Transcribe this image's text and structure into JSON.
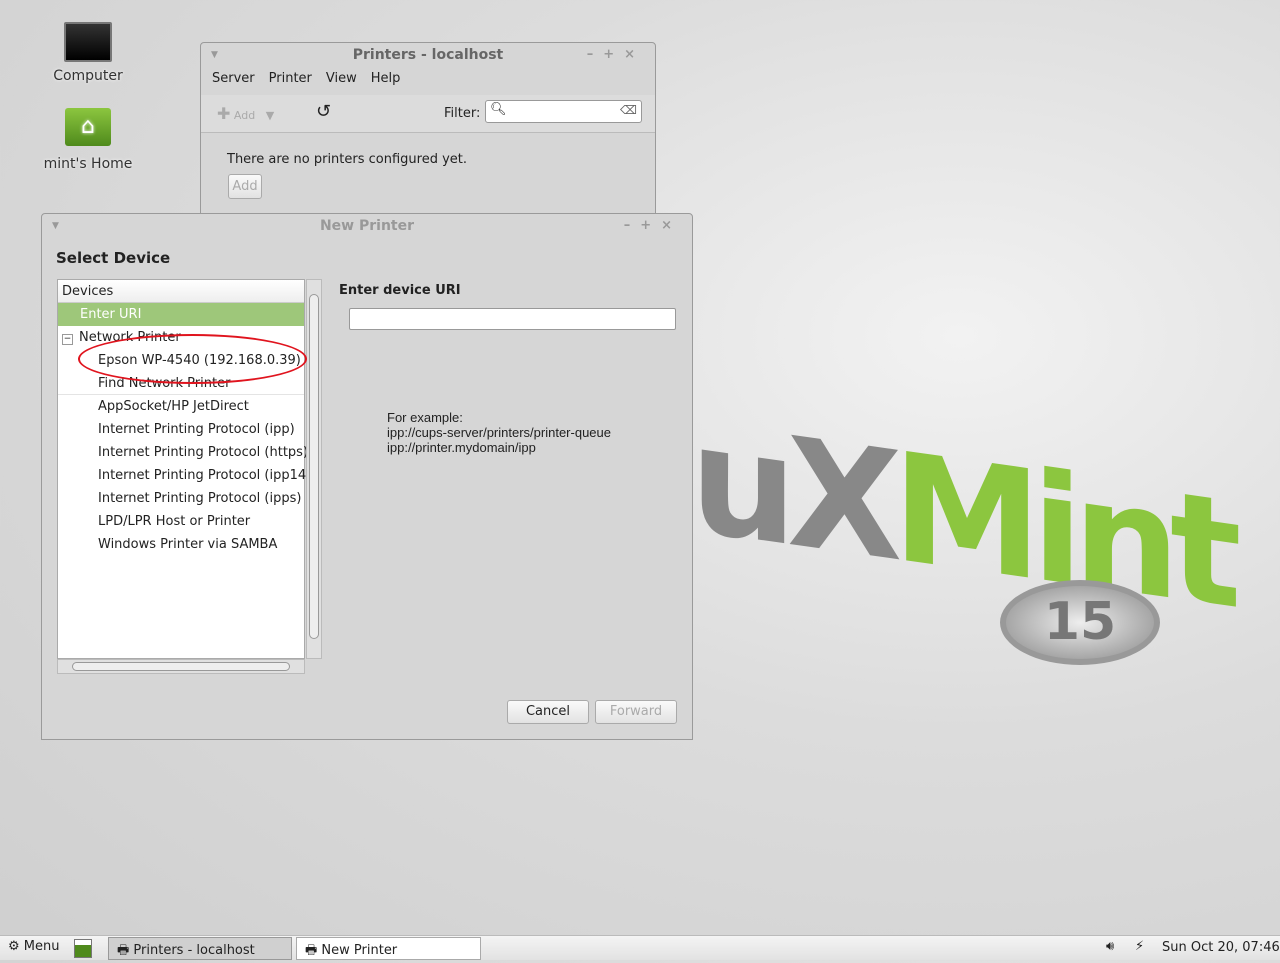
{
  "desktop": {
    "icons": [
      {
        "label": "Computer"
      },
      {
        "label": "mint's Home"
      }
    ],
    "logo": {
      "text_left": "nuX",
      "text_right": "Mint",
      "version": "15"
    }
  },
  "printers_window": {
    "title": "Printers - localhost",
    "menu": [
      "Server",
      "Printer",
      "View",
      "Help"
    ],
    "toolbar": {
      "add_label": "Add",
      "filter_label": "Filter:",
      "filter_value": ""
    },
    "empty_message": "There are no printers configured yet.",
    "add_button": "Add"
  },
  "new_printer": {
    "title": "New Printer",
    "heading": "Select Device",
    "tree_header": "Devices",
    "items": [
      {
        "label": "Enter URI",
        "selected": true
      },
      {
        "label": "Network Printer",
        "expander": "−"
      },
      {
        "label": "Epson WP-4540 (192.168.0.39)",
        "annotated": true
      },
      {
        "label": "Find Network Printer"
      },
      {
        "label": "AppSocket/HP JetDirect"
      },
      {
        "label": "Internet Printing Protocol (ipp)"
      },
      {
        "label": "Internet Printing Protocol (https)"
      },
      {
        "label": "Internet Printing Protocol (ipp14)"
      },
      {
        "label": "Internet Printing Protocol (ipps)"
      },
      {
        "label": "LPD/LPR Host or Printer"
      },
      {
        "label": "Windows Printer via SAMBA"
      }
    ],
    "uri_label": "Enter device URI",
    "uri_value": "",
    "example_title": "For example:",
    "examples": [
      "ipp://cups-server/printers/printer-queue",
      "ipp://printer.mydomain/ipp"
    ],
    "cancel": "Cancel",
    "forward": "Forward"
  },
  "taskbar": {
    "menu": "Menu",
    "tasks": [
      "Printers - localhost",
      "New Printer"
    ],
    "clock": "Sun Oct 20, 07:46"
  },
  "colors": {
    "selection": "#9ec77a",
    "annotation": "#e0141e",
    "mint_green": "#8cc63f"
  }
}
